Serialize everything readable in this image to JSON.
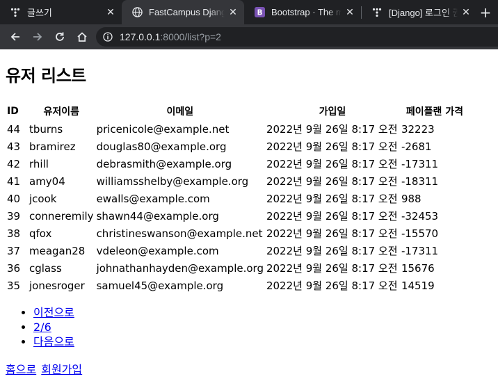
{
  "browser": {
    "tabs": [
      {
        "title": "글쓰기",
        "favicon": "tistory-icon",
        "active": false
      },
      {
        "title": "FastCampus Django",
        "favicon": "globe-icon",
        "active": true
      },
      {
        "title": "Bootstrap · The mo",
        "favicon": "bootstrap-icon",
        "active": false
      },
      {
        "title": "[Django] 로그인 권",
        "favicon": "tistory-icon",
        "active": false
      }
    ],
    "url_host": "127.0.0.1",
    "url_path": ":8000/list?p=2"
  },
  "page": {
    "title": "유저 리스트",
    "table": {
      "headers": [
        "ID",
        "유저이름",
        "이메일",
        "가입일",
        "페이플랜 가격"
      ],
      "rows": [
        [
          "44",
          "tburns",
          "pricenicole@example.net",
          "2022년 9월 26일 8:17 오전",
          "32223"
        ],
        [
          "43",
          "bramirez",
          "douglas80@example.org",
          "2022년 9월 26일 8:17 오전",
          "-2681"
        ],
        [
          "42",
          "rhill",
          "debrasmith@example.org",
          "2022년 9월 26일 8:17 오전",
          "-17311"
        ],
        [
          "41",
          "amy04",
          "williamsshelby@example.org",
          "2022년 9월 26일 8:17 오전",
          "-18311"
        ],
        [
          "40",
          "jcook",
          "ewalls@example.com",
          "2022년 9월 26일 8:17 오전",
          "988"
        ],
        [
          "39",
          "conneremily",
          "shawn44@example.org",
          "2022년 9월 26일 8:17 오전",
          "-32453"
        ],
        [
          "38",
          "qfox",
          "christineswanson@example.net",
          "2022년 9월 26일 8:17 오전",
          "-15570"
        ],
        [
          "37",
          "meagan28",
          "vdeleon@example.com",
          "2022년 9월 26일 8:17 오전",
          "-17311"
        ],
        [
          "36",
          "cglass",
          "johnathanhayden@example.org",
          "2022년 9월 26일 8:17 오전",
          "15676"
        ],
        [
          "35",
          "jonesroger",
          "samuel45@example.org",
          "2022년 9월 26일 8:17 오전",
          "14519"
        ]
      ]
    },
    "pagination": {
      "prev": "이전으로",
      "current": "2/6",
      "next": "다음으로"
    },
    "links": {
      "home": "홈으로",
      "signup": "회원가입"
    }
  },
  "colors": {
    "tab_bar": "#202124",
    "toolbar": "#35363a",
    "link": "#0000ee"
  }
}
